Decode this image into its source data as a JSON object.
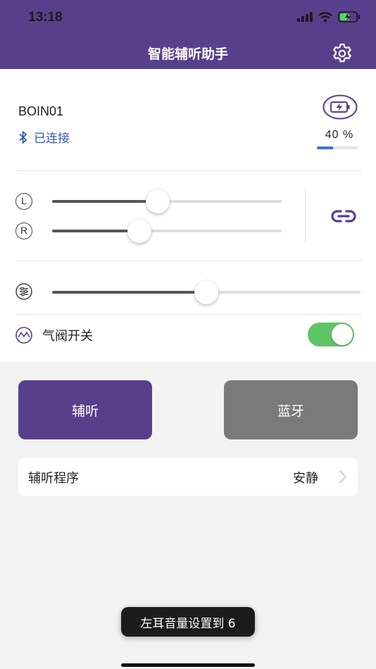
{
  "status_bar": {
    "time": "13:18"
  },
  "header": {
    "title": "智能辅听助手",
    "settings_icon": "gear-icon"
  },
  "device": {
    "name": "BOIN01",
    "connection_status": "已连接",
    "battery_percent_label": "40 %",
    "battery_level": 0.4
  },
  "volume": {
    "left_label": "L",
    "right_label": "R",
    "left_level": 0.46,
    "right_level": 0.38,
    "link_icon": "link-icon"
  },
  "equalizer": {
    "level": 0.5
  },
  "air_valve": {
    "label": "气阀开关",
    "enabled": true
  },
  "mode_buttons": {
    "hearing_label": "辅听",
    "bluetooth_label": "蓝牙"
  },
  "program": {
    "label": "辅听程序",
    "value": "安静"
  },
  "toast": {
    "message": "左耳音量设置到 6"
  },
  "colors": {
    "brand_purple": "#573f8c",
    "toggle_green": "#5ec464",
    "link_blue": "#3557b5",
    "inactive_gray": "#7a7a7a"
  }
}
